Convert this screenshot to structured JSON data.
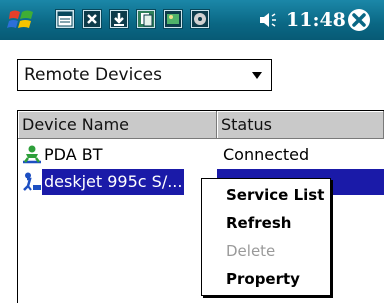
{
  "taskbar": {
    "time": "11:48",
    "icons": [
      "windows-flag-icon",
      "window-icon",
      "close-box-icon",
      "download-icon",
      "pages-icon",
      "picture-icon",
      "disc-icon",
      "speaker-icon",
      "close-circle-icon"
    ],
    "colors": {
      "bar": "#0a6784",
      "text": "#ffffff"
    }
  },
  "dropdown": {
    "selected": "Remote Devices"
  },
  "list": {
    "columns": [
      "Device Name",
      "Status"
    ],
    "rows": [
      {
        "name": "PDA BT",
        "status": "Connected",
        "icon": "pda-person-icon",
        "selected": false
      },
      {
        "name": "deskjet 995c S/...",
        "status": "",
        "icon": "printer-person-icon",
        "selected": true
      }
    ],
    "selection_color": "#1a1aa8"
  },
  "context_menu": {
    "items": [
      {
        "label": "Service List",
        "enabled": true
      },
      {
        "label": "Refresh",
        "enabled": true
      },
      {
        "label": "Delete",
        "enabled": false
      },
      {
        "label": "Property",
        "enabled": true
      }
    ]
  }
}
